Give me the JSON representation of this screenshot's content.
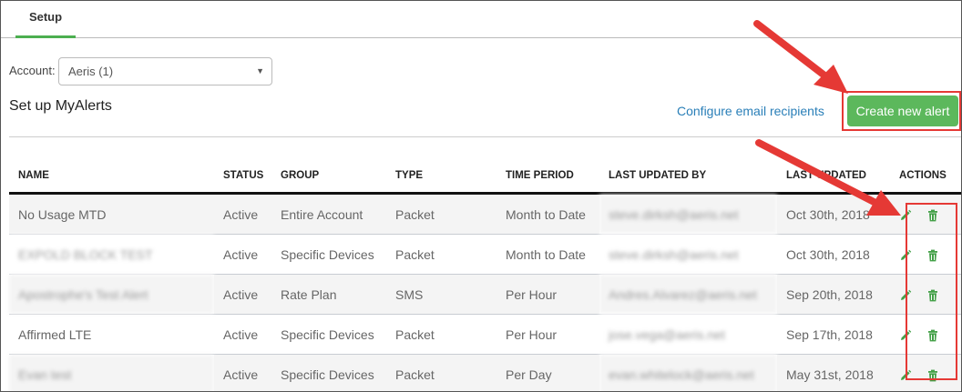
{
  "tabs": [
    {
      "label": "Setup",
      "active": true
    }
  ],
  "account": {
    "label": "Account:",
    "selected": "Aeris (1)"
  },
  "page_title": "Set up MyAlerts",
  "configure_link": "Configure email recipients",
  "create_button": "Create new alert",
  "table": {
    "columns": [
      "NAME",
      "STATUS",
      "GROUP",
      "TYPE",
      "TIME PERIOD",
      "LAST UPDATED BY",
      "LAST UPDATED",
      "ACTIONS"
    ],
    "rows": [
      {
        "name": "No Usage MTD",
        "status": "Active",
        "group": "Entire Account",
        "type": "Packet",
        "period": "Month to Date",
        "updated_by": "steve.dirksh@aeris.net",
        "updated": "Oct 30th, 2018"
      },
      {
        "name": "EXPOLD BLOCK TEST",
        "status": "Active",
        "group": "Specific Devices",
        "type": "Packet",
        "period": "Month to Date",
        "updated_by": "steve.dirksh@aeris.net",
        "updated": "Oct 30th, 2018"
      },
      {
        "name": "Apostrophe's Test Alert",
        "status": "Active",
        "group": "Rate Plan",
        "type": "SMS",
        "period": "Per Hour",
        "updated_by": "Andres.Alvarez@aeris.net",
        "updated": "Sep 20th, 2018"
      },
      {
        "name": "Affirmed LTE",
        "status": "Active",
        "group": "Specific Devices",
        "type": "Packet",
        "period": "Per Hour",
        "updated_by": "jose.vega@aeris.net",
        "updated": "Sep 17th, 2018"
      },
      {
        "name": "Evan test",
        "status": "Active",
        "group": "Specific Devices",
        "type": "Packet",
        "period": "Per Day",
        "updated_by": "evan.whitelock@aeris.net",
        "updated": "May 31st, 2018"
      }
    ]
  },
  "icons": {
    "edit": "pencil-icon",
    "delete": "trash-icon"
  },
  "colors": {
    "accent_green": "#5cb85c",
    "tab_underline": "#4caf50",
    "link": "#2a7fb8",
    "annotation_red": "#e53935",
    "edit_icon": "#43a047",
    "delete_icon": "#43a047"
  }
}
